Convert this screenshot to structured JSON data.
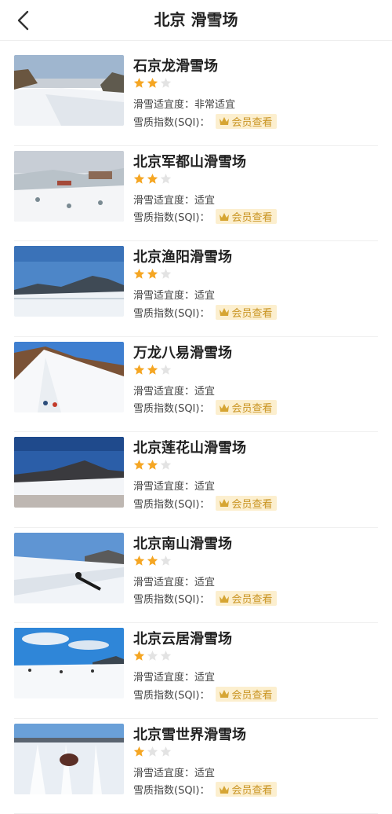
{
  "header": {
    "title": "北京 滑雪场",
    "back_icon": "chevron-left-icon"
  },
  "colors": {
    "star_filled": "#f5a623",
    "star_empty": "#e3e3e3",
    "vip_bg": "#fcefcf",
    "vip_text": "#c99422"
  },
  "labels": {
    "suitability_prefix": "滑雪适宜度：",
    "sqi_label": "雪质指数(SQI)：",
    "vip_button": "会员查看"
  },
  "resorts": [
    {
      "name": "石京龙滑雪场",
      "rating": 2,
      "max_rating": 3,
      "suitability_label": "滑雪适宜度：非常适宜",
      "sqi_label": "雪质指数(SQI)：",
      "vip_label": "会员查看"
    },
    {
      "name": "北京军都山滑雪场",
      "rating": 2,
      "max_rating": 3,
      "suitability_label": "滑雪适宜度：适宜",
      "sqi_label": "雪质指数(SQI)：",
      "vip_label": "会员查看"
    },
    {
      "name": "北京渔阳滑雪场",
      "rating": 2,
      "max_rating": 3,
      "suitability_label": "滑雪适宜度：适宜",
      "sqi_label": "雪质指数(SQI)：",
      "vip_label": "会员查看"
    },
    {
      "name": "万龙八易滑雪场",
      "rating": 2,
      "max_rating": 3,
      "suitability_label": "滑雪适宜度：适宜",
      "sqi_label": "雪质指数(SQI)：",
      "vip_label": "会员查看"
    },
    {
      "name": "北京莲花山滑雪场",
      "rating": 2,
      "max_rating": 3,
      "suitability_label": "滑雪适宜度：适宜",
      "sqi_label": "雪质指数(SQI)：",
      "vip_label": "会员查看"
    },
    {
      "name": "北京南山滑雪场",
      "rating": 2,
      "max_rating": 3,
      "suitability_label": "滑雪适宜度：适宜",
      "sqi_label": "雪质指数(SQI)：",
      "vip_label": "会员查看"
    },
    {
      "name": "北京云居滑雪场",
      "rating": 1,
      "max_rating": 3,
      "suitability_label": "滑雪适宜度：适宜",
      "sqi_label": "雪质指数(SQI)：",
      "vip_label": "会员查看"
    },
    {
      "name": "北京雪世界滑雪场",
      "rating": 1,
      "max_rating": 3,
      "suitability_label": "滑雪适宜度：适宜",
      "sqi_label": "雪质指数(SQI)：",
      "vip_label": "会员查看"
    }
  ]
}
